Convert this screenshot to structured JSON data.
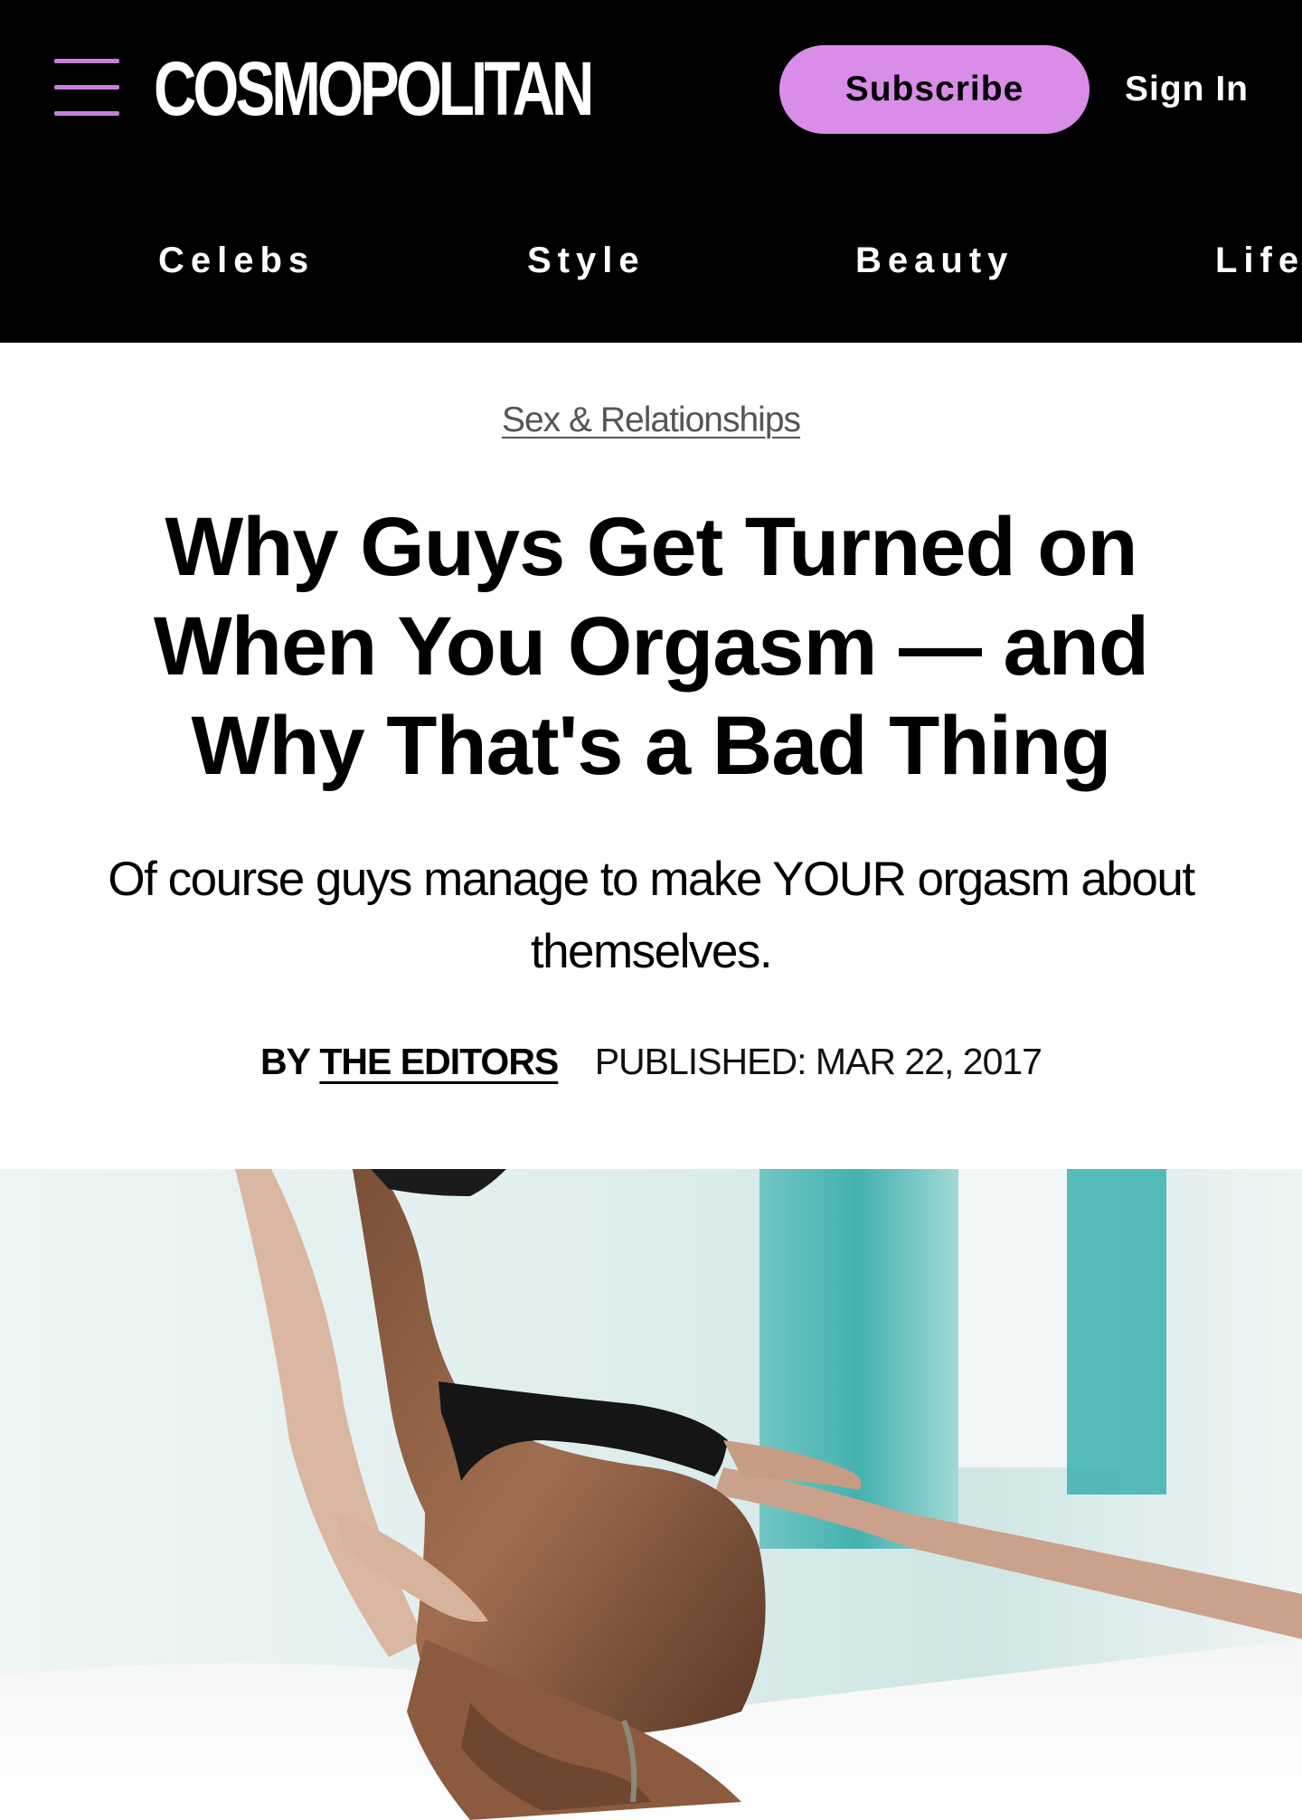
{
  "header": {
    "logo_text": "COSMOPOLITAN",
    "subscribe_label": "Subscribe",
    "signin_label": "Sign In",
    "menu_icon": "hamburger-menu-icon"
  },
  "nav": {
    "items": [
      "Celebs",
      "Style",
      "Beauty",
      "Life"
    ]
  },
  "article": {
    "category": "Sex & Relationships",
    "headline": "Why Guys Get Turned on When You Orgasm — and Why That's a Bad Thing",
    "dek": "Of course guys manage to make YOUR orgasm about themselves.",
    "byline_prefix": "BY",
    "author": "THE EDITORS",
    "published": "PUBLISHED: MAR 22, 2017"
  },
  "colors": {
    "header_bg": "#000000",
    "accent": "#d98de8",
    "menu_icon": "#c77fd9",
    "category_text": "#555555"
  }
}
